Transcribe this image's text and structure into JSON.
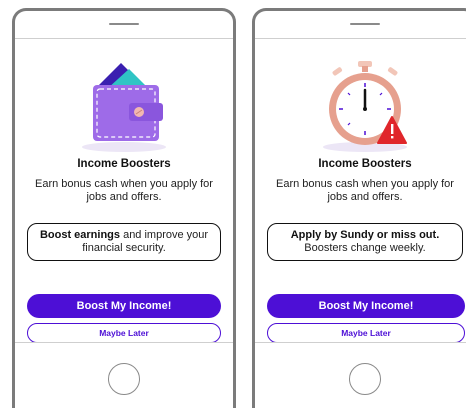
{
  "colors": {
    "primary": "#4d0fd6",
    "wallet": "#9e6be8",
    "stopwatch_ring": "#e6a08e",
    "alert": "#e0262b"
  },
  "screens": [
    {
      "illustration": "wallet-icon",
      "title": "Income Boosters",
      "subtitle": "Earn bonus cash when you apply for jobs and offers.",
      "callout_bold": "Boost earnings",
      "callout_rest": " and improve your financial security.",
      "primary_button": "Boost My Income!",
      "secondary_button": "Maybe Later"
    },
    {
      "illustration": "stopwatch-alert-icon",
      "title": "Income Boosters",
      "subtitle": "Earn bonus cash when you apply for jobs and offers.",
      "callout_line1": "Apply by Sundy or miss out.",
      "callout_line2": "Boosters change weekly.",
      "primary_button": "Boost My Income!",
      "secondary_button": "Maybe Later"
    }
  ]
}
